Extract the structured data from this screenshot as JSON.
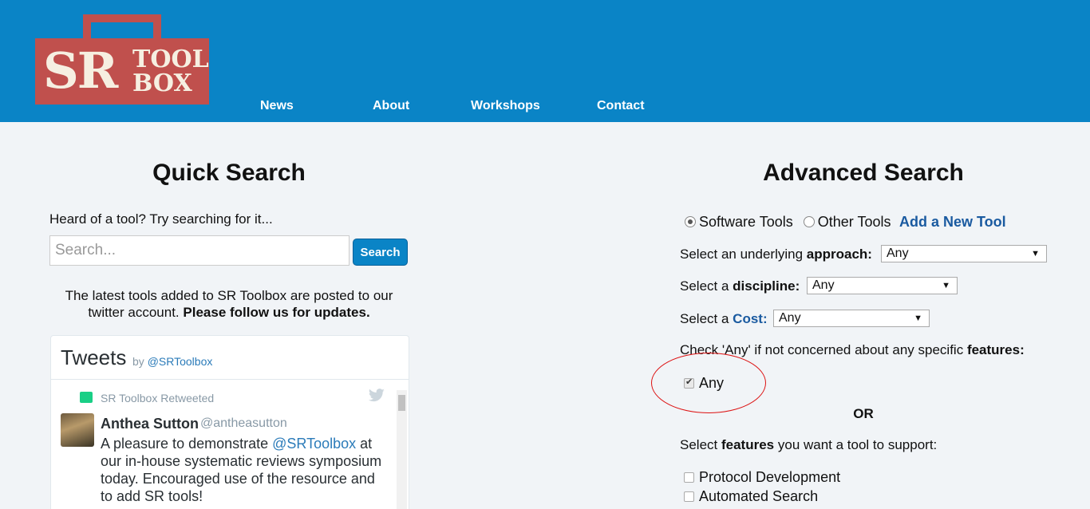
{
  "logo": {
    "sr": "SR",
    "tool": "TOOL",
    "box": "BOX"
  },
  "nav": {
    "items": [
      "News",
      "About",
      "Workshops",
      "Contact"
    ]
  },
  "quick_search": {
    "title": "Quick Search",
    "hint": "Heard of a tool? Try searching for it...",
    "placeholder": "Search...",
    "button": "Search",
    "latest_text": "The latest tools added to SR Toolbox are posted to our twitter account.",
    "latest_bold": "Please follow us for updates."
  },
  "tweets": {
    "title": "Tweets",
    "by": "by",
    "by_handle": "@SRToolbox",
    "retweeted": "SR Toolbox Retweeted",
    "author_name": "Anthea Sutton",
    "author_handle": "@antheasutton",
    "text_before": "A pleasure to demonstrate",
    "mention": "@SRToolbox",
    "text_after": "at our in-house systematic reviews symposium today. Encouraged use of the resource and to add SR tools!"
  },
  "advanced_search": {
    "title": "Advanced Search",
    "radio_software": "Software Tools",
    "radio_other": "Other Tools",
    "add_tool": "Add a New Tool",
    "approach_label": "Select an underlying",
    "approach_bold": "approach:",
    "approach_value": "Any",
    "discipline_label": "Select a",
    "discipline_bold": "discipline:",
    "discipline_value": "Any",
    "cost_label": "Select a",
    "cost_bold": "Cost:",
    "cost_value": "Any",
    "features_hint": "Check 'Any' if not concerned about any specific",
    "features_hint_bold": "features:",
    "any_label": "Any",
    "or": "OR",
    "select_features": "Select",
    "select_features_bold": "features",
    "select_features_tail": "you want a tool to support:",
    "feature_options": [
      "Protocol Development",
      "Automated Search"
    ]
  },
  "colors": {
    "header": "#0a84c6",
    "logo": "#c0504d",
    "link": "#1a5aa0"
  }
}
